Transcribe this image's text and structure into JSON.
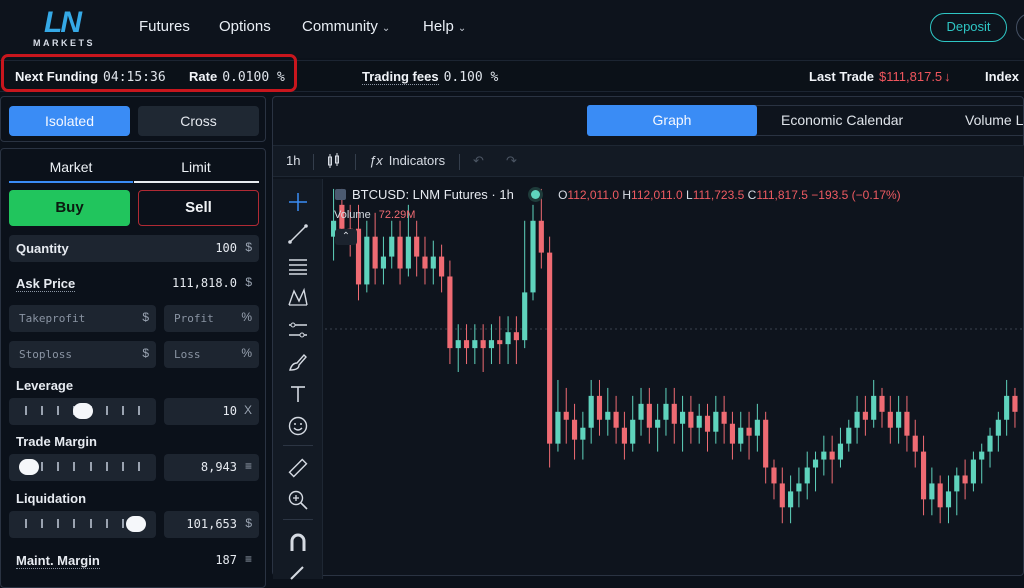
{
  "nav": {
    "logo_mark": "LN",
    "logo_sub": "MARKETS",
    "items": [
      {
        "label": "Futures"
      },
      {
        "label": "Options"
      },
      {
        "label": "Community"
      },
      {
        "label": "Help"
      }
    ],
    "deposit_label": "Deposit"
  },
  "info": {
    "next_funding_label": "Next Funding",
    "next_funding_value": "04:15:36",
    "rate_label": "Rate",
    "rate_value": "0.0100 %",
    "fees_label": "Trading fees",
    "fees_value": "0.100 %",
    "last_trade_label": "Last Trade",
    "last_trade_value": "$111,817.5",
    "index_label": "Index"
  },
  "order": {
    "isolated": "Isolated",
    "cross": "Cross",
    "tab_market": "Market",
    "tab_limit": "Limit",
    "buy": "Buy",
    "sell": "Sell",
    "quantity_label": "Quantity",
    "quantity_value": "100",
    "quantity_unit": "$",
    "ask_label": "Ask Price",
    "ask_value": "111,818.0",
    "ask_unit": "$",
    "takeprofit_placeholder": "Takeprofit",
    "takeprofit_unit": "$",
    "profit_placeholder": "Profit",
    "profit_unit": "%",
    "stoploss_placeholder": "Stoploss",
    "stoploss_unit": "$",
    "loss_placeholder": "Loss",
    "loss_unit": "%",
    "leverage_label": "Leverage",
    "leverage_value": "10",
    "leverage_unit": "X",
    "leverage_level": 0.5,
    "margin_label": "Trade Margin",
    "margin_value": "8,943",
    "margin_unit": "≡",
    "margin_level": 0.0,
    "liq_label": "Liquidation",
    "liq_value": "101,653",
    "liq_unit": "$",
    "liq_level": 1.0,
    "maint_label": "Maint. Margin",
    "maint_value": "187",
    "maint_unit": "≡"
  },
  "chart": {
    "tabs": [
      "Graph",
      "Economic Calendar",
      "Volume La"
    ],
    "interval": "1h",
    "indicators": "Indicators",
    "symbol": "BTCUSD: LNM Futures · 1h",
    "o_label": "O",
    "o_value": "112,011.0",
    "h_label": "H",
    "h_value": "112,011.0",
    "l_label": "L",
    "l_value": "111,723.5",
    "c_label": "C",
    "c_value": "111,817.5",
    "change": "−193.5 (−0.17%)",
    "volume_label": "Volume",
    "volume_value": "72.29M",
    "up_color": "#5fd3bd",
    "down_color": "#ef6b73"
  },
  "chart_data": {
    "type": "candlestick",
    "title": "BTCUSD: LNM Futures · 1h",
    "candles": [
      [
        0,
        0.84,
        0.88,
        0.78,
        0.96
      ],
      [
        1,
        0.92,
        0.86,
        0.82,
        0.96
      ],
      [
        2,
        0.86,
        0.83,
        0.79,
        0.92
      ],
      [
        3,
        0.86,
        0.72,
        0.68,
        0.92
      ],
      [
        4,
        0.72,
        0.84,
        0.7,
        0.88
      ],
      [
        5,
        0.84,
        0.76,
        0.72,
        0.9
      ],
      [
        6,
        0.76,
        0.79,
        0.72,
        0.84
      ],
      [
        7,
        0.79,
        0.84,
        0.76,
        0.88
      ],
      [
        8,
        0.84,
        0.76,
        0.72,
        0.88
      ],
      [
        9,
        0.76,
        0.84,
        0.74,
        0.92
      ],
      [
        10,
        0.84,
        0.79,
        0.74,
        0.88
      ],
      [
        11,
        0.79,
        0.76,
        0.72,
        0.84
      ],
      [
        12,
        0.76,
        0.79,
        0.72,
        0.83
      ],
      [
        13,
        0.79,
        0.74,
        0.7,
        0.82
      ],
      [
        14,
        0.74,
        0.56,
        0.52,
        0.78
      ],
      [
        15,
        0.56,
        0.58,
        0.5,
        0.62
      ],
      [
        16,
        0.58,
        0.56,
        0.52,
        0.62
      ],
      [
        17,
        0.56,
        0.58,
        0.52,
        0.62
      ],
      [
        18,
        0.58,
        0.56,
        0.5,
        0.62
      ],
      [
        19,
        0.56,
        0.58,
        0.52,
        0.62
      ],
      [
        20,
        0.58,
        0.57,
        0.52,
        0.64
      ],
      [
        21,
        0.57,
        0.6,
        0.52,
        0.64
      ],
      [
        22,
        0.6,
        0.58,
        0.52,
        0.64
      ],
      [
        23,
        0.58,
        0.7,
        0.56,
        0.88
      ],
      [
        24,
        0.7,
        0.88,
        0.68,
        0.92
      ],
      [
        25,
        0.88,
        0.8,
        0.76,
        0.96
      ],
      [
        26,
        0.8,
        0.32,
        0.26,
        0.84
      ],
      [
        27,
        0.32,
        0.4,
        0.3,
        0.48
      ],
      [
        28,
        0.4,
        0.38,
        0.32,
        0.46
      ],
      [
        29,
        0.38,
        0.33,
        0.28,
        0.42
      ],
      [
        30,
        0.33,
        0.36,
        0.28,
        0.4
      ],
      [
        31,
        0.36,
        0.44,
        0.32,
        0.48
      ],
      [
        32,
        0.44,
        0.38,
        0.34,
        0.48
      ],
      [
        33,
        0.38,
        0.4,
        0.34,
        0.46
      ],
      [
        34,
        0.4,
        0.36,
        0.32,
        0.44
      ],
      [
        35,
        0.36,
        0.32,
        0.28,
        0.4
      ],
      [
        36,
        0.32,
        0.38,
        0.3,
        0.44
      ],
      [
        37,
        0.38,
        0.42,
        0.34,
        0.46
      ],
      [
        38,
        0.42,
        0.36,
        0.32,
        0.46
      ],
      [
        39,
        0.36,
        0.38,
        0.3,
        0.42
      ],
      [
        40,
        0.38,
        0.42,
        0.34,
        0.46
      ],
      [
        41,
        0.42,
        0.37,
        0.32,
        0.46
      ],
      [
        42,
        0.37,
        0.4,
        0.3,
        0.44
      ],
      [
        43,
        0.4,
        0.36,
        0.32,
        0.44
      ],
      [
        44,
        0.36,
        0.39,
        0.32,
        0.42
      ],
      [
        45,
        0.39,
        0.35,
        0.3,
        0.42
      ],
      [
        46,
        0.35,
        0.4,
        0.32,
        0.44
      ],
      [
        47,
        0.4,
        0.37,
        0.32,
        0.44
      ],
      [
        48,
        0.37,
        0.32,
        0.28,
        0.4
      ],
      [
        49,
        0.32,
        0.36,
        0.3,
        0.4
      ],
      [
        50,
        0.36,
        0.34,
        0.28,
        0.4
      ],
      [
        51,
        0.34,
        0.38,
        0.3,
        0.42
      ],
      [
        52,
        0.38,
        0.26,
        0.22,
        0.4
      ],
      [
        53,
        0.26,
        0.22,
        0.18,
        0.28
      ],
      [
        54,
        0.22,
        0.16,
        0.12,
        0.26
      ],
      [
        55,
        0.16,
        0.2,
        0.12,
        0.24
      ],
      [
        56,
        0.2,
        0.22,
        0.16,
        0.26
      ],
      [
        57,
        0.22,
        0.26,
        0.18,
        0.3
      ],
      [
        58,
        0.26,
        0.28,
        0.2,
        0.3
      ],
      [
        59,
        0.28,
        0.3,
        0.24,
        0.34
      ],
      [
        60,
        0.3,
        0.28,
        0.22,
        0.34
      ],
      [
        61,
        0.28,
        0.32,
        0.26,
        0.36
      ],
      [
        62,
        0.32,
        0.36,
        0.3,
        0.38
      ],
      [
        63,
        0.36,
        0.4,
        0.32,
        0.44
      ],
      [
        64,
        0.4,
        0.38,
        0.34,
        0.44
      ],
      [
        65,
        0.38,
        0.44,
        0.36,
        0.48
      ],
      [
        66,
        0.44,
        0.4,
        0.36,
        0.46
      ],
      [
        67,
        0.4,
        0.36,
        0.32,
        0.44
      ],
      [
        68,
        0.36,
        0.4,
        0.32,
        0.44
      ],
      [
        69,
        0.4,
        0.34,
        0.3,
        0.44
      ],
      [
        70,
        0.34,
        0.3,
        0.26,
        0.38
      ],
      [
        71,
        0.3,
        0.18,
        0.14,
        0.34
      ],
      [
        72,
        0.18,
        0.22,
        0.14,
        0.26
      ],
      [
        73,
        0.22,
        0.16,
        0.12,
        0.24
      ],
      [
        74,
        0.16,
        0.2,
        0.12,
        0.24
      ],
      [
        75,
        0.2,
        0.24,
        0.14,
        0.26
      ],
      [
        76,
        0.24,
        0.22,
        0.18,
        0.28
      ],
      [
        77,
        0.22,
        0.28,
        0.2,
        0.3
      ],
      [
        78,
        0.28,
        0.3,
        0.22,
        0.32
      ],
      [
        79,
        0.3,
        0.34,
        0.26,
        0.36
      ],
      [
        80,
        0.34,
        0.38,
        0.3,
        0.4
      ],
      [
        81,
        0.38,
        0.44,
        0.34,
        0.48
      ],
      [
        82,
        0.44,
        0.4,
        0.36,
        0.46
      ]
    ]
  }
}
